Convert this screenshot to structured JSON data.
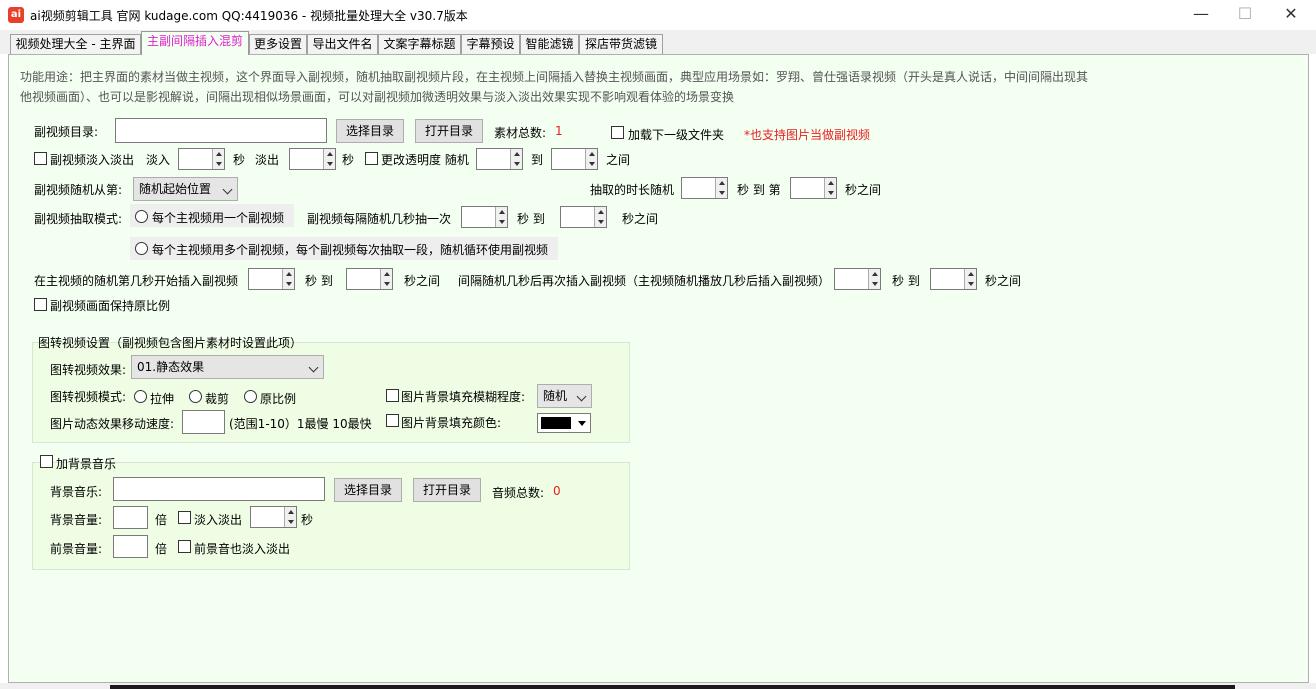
{
  "window": {
    "title": "ai视频剪辑工具 官网 kudage.com QQ:4419036 -  视频批量处理大全  v30.7版本",
    "icon_text": "ai",
    "minimize": "—",
    "maximize": "☐",
    "close": "✕"
  },
  "tabs": [
    "视频处理大全 - 主界面",
    "主副间隔插入混剪",
    "更多设置",
    "导出文件名",
    "文案字幕标题",
    "字幕预设",
    "智能滤镜",
    "探店带货滤镜"
  ],
  "description": {
    "line1": "功能用途：把主界面的素材当做主视频，这个界面导入副视频，随机抽取副视频片段，在主视频上间隔插入替换主视频画面，典型应用场景如：罗翔、曾仕强语录视频（开头是真人说话，中间间隔出现其",
    "line2": "他视频画面）、也可以是影视解说，间隔出现相似场景画面，可以对副视频加微透明效果与淡入淡出效果实现不影响观看体验的场景变换"
  },
  "sub_video": {
    "dir_label": "副视频目录:",
    "dir_value": "",
    "select_dir": "选择目录",
    "open_dir": "打开目录",
    "total_label": "素材总数:",
    "total_value": "1",
    "load_subfolder": "加载下一级文件夹",
    "image_note": "*也支持图片当做副视频"
  },
  "fade": {
    "fade_label": "副视频淡入淡出",
    "in_label": "淡入",
    "in_value": "",
    "sec1": "秒",
    "out_label": "淡出",
    "out_value": "",
    "sec2": "秒",
    "opacity_label": "更改透明度 随机",
    "opacity_from": "",
    "to": "到",
    "opacity_to": "",
    "between": "之间"
  },
  "random_from": {
    "label": "副视频随机从第:",
    "select": "随机起始位置",
    "duration_label": "抽取的时长随机",
    "duration_from": "",
    "sec_to_nth": "秒 到 第",
    "duration_to": "",
    "sec_between": "秒之间"
  },
  "extract_mode": {
    "label": "副视频抽取模式:",
    "option1": "每个主视频用一个副视频",
    "interval_label": "副视频每隔随机几秒抽一次",
    "interval_from": "",
    "sec_to": "秒 到",
    "interval_to": "",
    "sec_between": "秒之间",
    "option2": "每个主视频用多个副视频，每个副视频每次抽取一段，随机循环使用副视频"
  },
  "insert": {
    "start_label": "在主视频的随机第几秒开始插入副视频",
    "start_from": "",
    "sec_to": "秒 到",
    "start_to": "",
    "sec_between": "秒之间",
    "repeat_label": "间隔随机几秒后再次插入副视频（主视频随机播放几秒后插入副视频）",
    "repeat_from": "",
    "sec_to2": "秒 到",
    "repeat_to": "",
    "sec_between2": "秒之间",
    "keep_ratio": "副视频画面保持原比例"
  },
  "image_group": {
    "title": "图转视频设置（副视频包含图片素材时设置此项）",
    "effect_label": "图转视频效果:",
    "effect_value": "01.静态效果",
    "mode_label": "图转视频模式:",
    "mode_stretch": "拉伸",
    "mode_crop": "裁剪",
    "mode_original": "原比例",
    "blur_label": "图片背景填充模糊程度:",
    "blur_value": "随机",
    "speed_label": "图片动态效果移动速度:",
    "speed_value": "",
    "speed_hint": "(范围1-10）1最慢 10最快",
    "color_label": "图片背景填充颜色:",
    "color_value": "#000000"
  },
  "music_group": {
    "title": "加背景音乐",
    "music_label": "背景音乐:",
    "music_value": "",
    "select_dir": "选择目录",
    "open_dir": "打开目录",
    "total_label": "音频总数:",
    "total_value": "0",
    "bg_volume_label": "背景音量:",
    "bg_volume": "",
    "times1": "倍",
    "fade_label": "淡入淡出",
    "fade_value": "",
    "sec": "秒",
    "fg_volume_label": "前景音量:",
    "fg_volume": "",
    "times2": "倍",
    "fg_fade_label": "前景音也淡入淡出"
  }
}
